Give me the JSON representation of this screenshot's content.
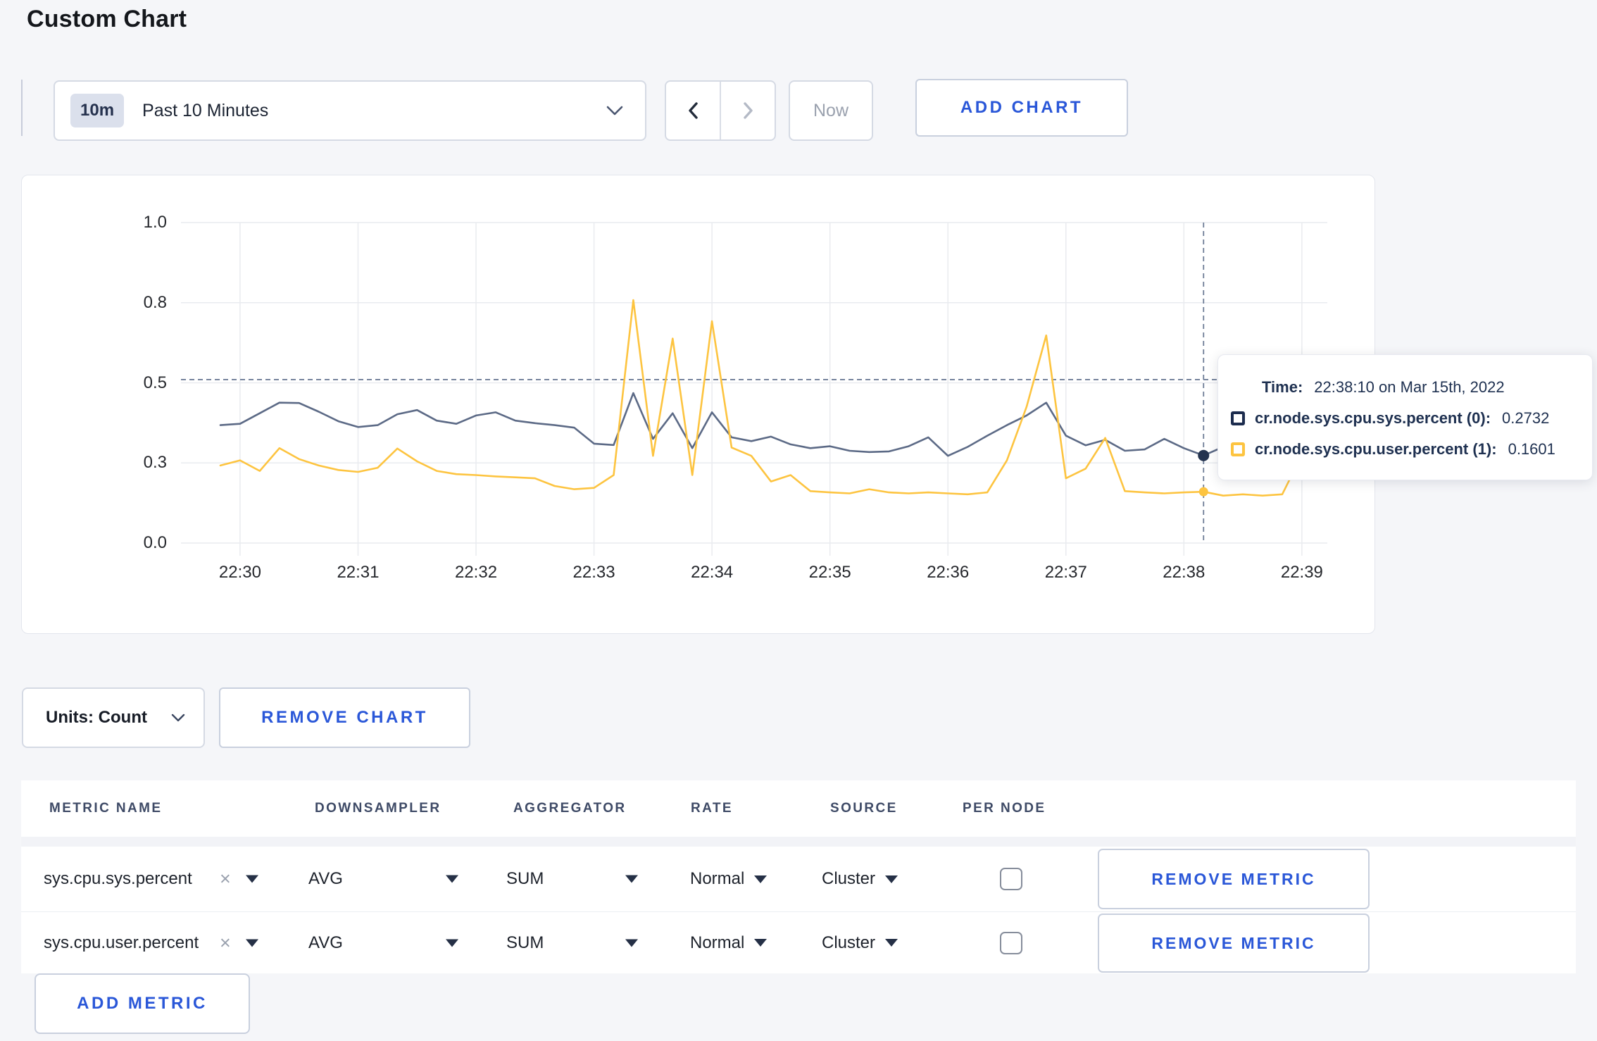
{
  "page": {
    "title": "Custom Chart"
  },
  "colors": {
    "accent": "#2a57d8",
    "navy": "#1e3050",
    "title_text": "#14171c",
    "text": "#1d222b",
    "muted": "#9aa1ae",
    "header_text": "#3e4a66",
    "border": "#d5dae4",
    "button_border": "#c9d0de",
    "badge_bg": "#dbe0ec",
    "grid": "#e9ebef",
    "crosshair": "#6d7c96",
    "series_sys": "#5c6a86",
    "series_user": "#fdc440",
    "page_bg": "#f5f6f9"
  },
  "icons": {
    "time_range_chevron": "chevron-down",
    "prev": "chevron-left",
    "next": "chevron-right",
    "units_chevron": "chevron-down",
    "metric_clear": "×",
    "select_caret": "triangle-down",
    "per_node_checkbox": "checkbox-unchecked"
  },
  "toolbar": {
    "time_range": {
      "badge": "10m",
      "label": "Past 10 Minutes"
    },
    "now_label": "Now",
    "add_chart_label": "ADD CHART"
  },
  "chart": {
    "units_label": "Units: Count",
    "remove_chart_label": "REMOVE CHART",
    "tooltip": {
      "time_label": "Time:",
      "time_value": "22:38:10 on Mar 15th, 2022",
      "series": [
        {
          "name": "cr.node.sys.cpu.sys.percent (0):",
          "value": "0.2732",
          "color": "#1c2c4e"
        },
        {
          "name": "cr.node.sys.cpu.user.percent (1):",
          "value": "0.1601",
          "color": "#fdc440"
        }
      ]
    }
  },
  "chart_data": {
    "type": "line",
    "x_start_label": "22:29:50",
    "x_step_seconds": 10,
    "x_tick_offsets_s": [
      10,
      70,
      130,
      190,
      250,
      310,
      370,
      430,
      490,
      550
    ],
    "x_tick_labels": [
      "22:30",
      "22:31",
      "22:32",
      "22:33",
      "22:34",
      "22:35",
      "22:36",
      "22:37",
      "22:38",
      "22:39"
    ],
    "y_ticks": [
      {
        "v": 0,
        "label": "0.0"
      },
      {
        "v": 0.25,
        "label": "0.3"
      },
      {
        "v": 0.5,
        "label": "0.5"
      },
      {
        "v": 0.75,
        "label": "0.8"
      },
      {
        "v": 1,
        "label": "1.0"
      }
    ],
    "ylim": [
      0,
      1
    ],
    "grid": true,
    "series": [
      {
        "name": "cr.node.sys.cpu.sys.percent",
        "color": "#5c6a86",
        "dot_color": "#24334f",
        "values": [
          0.368,
          0.372,
          0.405,
          0.438,
          0.437,
          0.41,
          0.38,
          0.362,
          0.368,
          0.402,
          0.415,
          0.382,
          0.372,
          0.398,
          0.408,
          0.382,
          0.374,
          0.368,
          0.36,
          0.31,
          0.306,
          0.468,
          0.325,
          0.405,
          0.296,
          0.408,
          0.33,
          0.318,
          0.332,
          0.308,
          0.296,
          0.302,
          0.288,
          0.284,
          0.286,
          0.302,
          0.33,
          0.272,
          0.3,
          0.335,
          0.368,
          0.398,
          0.438,
          0.335,
          0.305,
          0.322,
          0.288,
          0.292,
          0.325,
          0.296,
          0.2732,
          0.3,
          0.288,
          0.296,
          0.31,
          0.318,
          0.302
        ]
      },
      {
        "name": "cr.node.sys.cpu.user.percent",
        "color": "#fdc440",
        "dot_color": "#fdc440",
        "values": [
          0.242,
          0.258,
          0.225,
          0.296,
          0.262,
          0.242,
          0.228,
          0.222,
          0.235,
          0.295,
          0.255,
          0.225,
          0.215,
          0.212,
          0.208,
          0.205,
          0.202,
          0.178,
          0.168,
          0.172,
          0.212,
          0.758,
          0.272,
          0.638,
          0.212,
          0.692,
          0.298,
          0.272,
          0.192,
          0.212,
          0.162,
          0.158,
          0.155,
          0.168,
          0.158,
          0.155,
          0.158,
          0.155,
          0.152,
          0.158,
          0.258,
          0.425,
          0.648,
          0.202,
          0.232,
          0.328,
          0.162,
          0.158,
          0.155,
          0.158,
          0.1601,
          0.148,
          0.152,
          0.148,
          0.152,
          0.275,
          0.242
        ]
      }
    ],
    "hover": {
      "index": 50,
      "time_label": "22:38:10",
      "crosshair_value": 0.51,
      "values": [
        0.2732,
        0.1601
      ]
    }
  },
  "metrics_table": {
    "headers": [
      "METRIC NAME",
      "DOWNSAMPLER",
      "AGGREGATOR",
      "RATE",
      "SOURCE",
      "PER NODE"
    ],
    "rows": [
      {
        "metric": "sys.cpu.sys.percent",
        "downsampler": "AVG",
        "aggregator": "SUM",
        "rate": "Normal",
        "source": "Cluster",
        "per_node_checked": false,
        "remove_label": "REMOVE METRIC"
      },
      {
        "metric": "sys.cpu.user.percent",
        "downsampler": "AVG",
        "aggregator": "SUM",
        "rate": "Normal",
        "source": "Cluster",
        "per_node_checked": false,
        "remove_label": "REMOVE METRIC"
      }
    ],
    "add_metric_label": "ADD METRIC"
  }
}
